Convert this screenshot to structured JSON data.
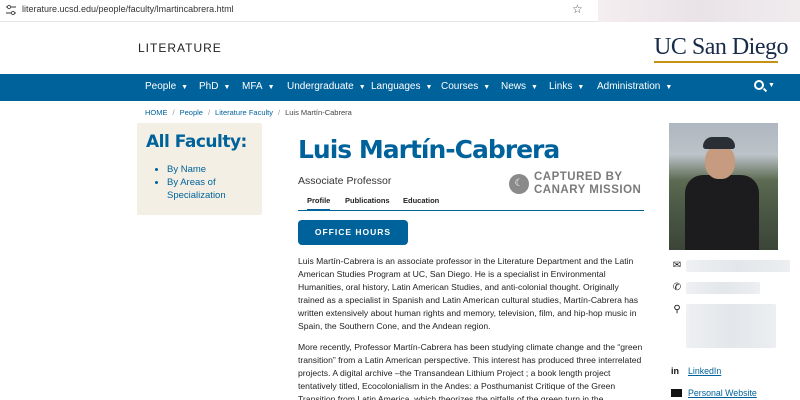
{
  "browser": {
    "url": "literature.ucsd.edu/people/faculty/lmartincabrera.html"
  },
  "header": {
    "dept": "LITERATURE",
    "brand": "UC San Diego"
  },
  "nav": {
    "items": [
      {
        "label": "People"
      },
      {
        "label": "PhD"
      },
      {
        "label": "MFA"
      },
      {
        "label": "Undergraduate"
      },
      {
        "label": "Languages"
      },
      {
        "label": "Courses"
      },
      {
        "label": "News"
      },
      {
        "label": "Links"
      },
      {
        "label": "Administration"
      }
    ]
  },
  "breadcrumb": {
    "home": "HOME",
    "people": "People",
    "faculty": "Literature Faculty",
    "current": "Luis Martín-Cabrera"
  },
  "sidebar": {
    "heading": "All Faculty:",
    "links": [
      "By Name",
      "By Areas of Specialization"
    ]
  },
  "profile": {
    "name": "Luis Martín-Cabrera",
    "title": "Associate Professor",
    "tabs": [
      "Profile",
      "Publications",
      "Education"
    ],
    "office_hours": "OFFICE HOURS",
    "bio1": "Luis Martín-Cabrera is an associate professor in the Literature Department and the Latin American Studies Program at UC, San Diego. He is a specialist in Environmental Humanities, oral history, Latin American Studies, and anti-colonial thought. Originally trained as a specialist in Spanish and Latin American cultural studies, Martín-Cabrera has written extensively about human rights and memory, television, film, and hip-hop music in Spain, the Southern Cone, and the Andean region.",
    "bio2": "More recently, Professor Martín-Cabrera has been studying climate change and the “green transition” from a Latin American perspective. This interest has produced three interrelated projects. A digital archive –the Transandean Lithium Project ; a book length project tentatively titled, Ecocolonialism in the Andes: a Posthumanist Critique of the Green Transition from Latin America, which theorizes the pitfalls of the green turn in the"
  },
  "stamp": {
    "line1": "CAPTURED BY",
    "line2": "CANARY MISSION"
  },
  "contact": {
    "linkedin": "LinkedIn",
    "website": "Personal Website"
  }
}
